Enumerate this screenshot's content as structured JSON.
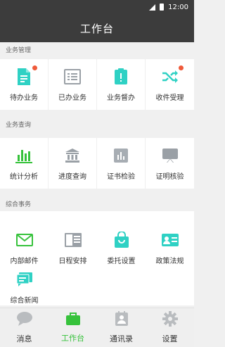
{
  "status": {
    "time": "12:00"
  },
  "header": {
    "title": "工作台"
  },
  "sections": {
    "business_mgmt": "业务管理",
    "business_query": "业务查询",
    "general": "综合事务"
  },
  "mgmt_items": [
    {
      "label": "待办业务"
    },
    {
      "label": "已办业务"
    },
    {
      "label": "业务督办"
    },
    {
      "label": "收件受理"
    }
  ],
  "query_items": [
    {
      "label": "统计分析"
    },
    {
      "label": "进度查询"
    },
    {
      "label": "证书检验"
    },
    {
      "label": "证明核验"
    }
  ],
  "general_items": [
    {
      "label": "内部邮件"
    },
    {
      "label": "日程安排"
    },
    {
      "label": "委托设置"
    },
    {
      "label": "政策法规"
    },
    {
      "label": "综合新闻"
    }
  ],
  "tabs": [
    {
      "label": "消息"
    },
    {
      "label": "工作台"
    },
    {
      "label": "通讯录"
    },
    {
      "label": "设置"
    }
  ],
  "colors": {
    "accent": "#36c23b",
    "teal": "#2fd1c4",
    "badge": "#ef5a3a",
    "gray_icon": "#9aa0a6"
  }
}
